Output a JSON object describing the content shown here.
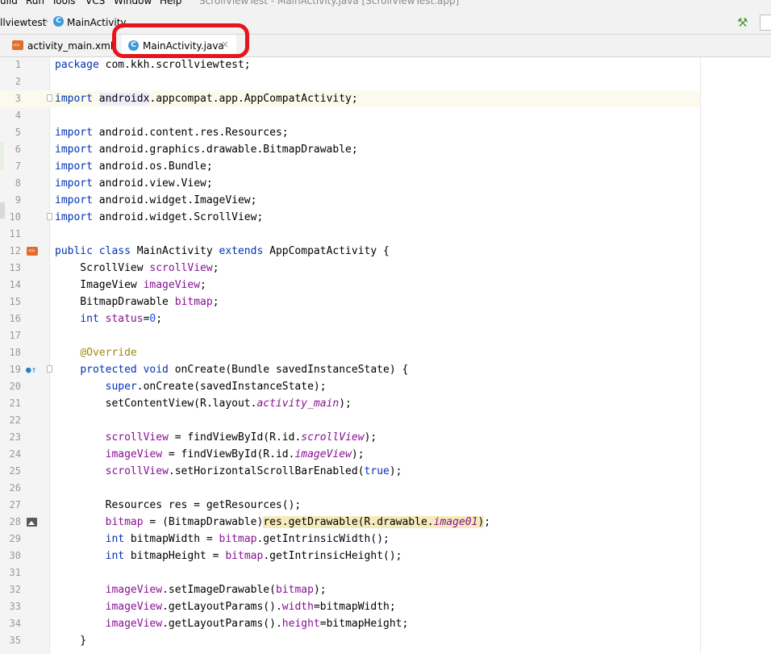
{
  "menubar": {
    "items": [
      "uild",
      "Run",
      "Tools",
      "VCS",
      "Window",
      "Help"
    ],
    "title": "ScrollViewTest - MainActivity.java [ScrollViewTest.app]"
  },
  "breadcrumb": {
    "project": "llviewtest",
    "file": "MainActivity",
    "file_icon_letter": "C"
  },
  "tabs": [
    {
      "label": "activity_main.xml",
      "icon": "xml-layout-icon",
      "active": false
    },
    {
      "label": "MainActivity.java",
      "icon": "java-class-icon",
      "icon_letter": "C",
      "active": true,
      "close": "×"
    }
  ],
  "colors": {
    "keyword": "#0033b3",
    "field": "#871094",
    "annotation": "#9e880d",
    "number": "#1750eb",
    "annotation_box": "#e8131c",
    "active_tab_underline": "#4083c9"
  },
  "editor": {
    "current_line": 3,
    "lines": [
      {
        "n": "1",
        "segs": [
          [
            "k",
            "package"
          ],
          [
            "t",
            " com.kkh.scrollviewtest;"
          ]
        ]
      },
      {
        "n": "2",
        "segs": []
      },
      {
        "n": "3",
        "segs": [
          [
            "k",
            "import"
          ],
          [
            "t",
            " "
          ],
          [
            "hl2",
            "androidx"
          ],
          [
            "t",
            ".appcompat.app.AppCompatActivity;"
          ]
        ],
        "fold": true
      },
      {
        "n": "4",
        "segs": []
      },
      {
        "n": "5",
        "segs": [
          [
            "k",
            "import"
          ],
          [
            "t",
            " android.content.res.Resources;"
          ]
        ]
      },
      {
        "n": "6",
        "segs": [
          [
            "k",
            "import"
          ],
          [
            "t",
            " android.graphics.drawable.BitmapDrawable;"
          ]
        ]
      },
      {
        "n": "7",
        "segs": [
          [
            "k",
            "import"
          ],
          [
            "t",
            " android.os.Bundle;"
          ]
        ]
      },
      {
        "n": "8",
        "segs": [
          [
            "k",
            "import"
          ],
          [
            "t",
            " android.view.View;"
          ]
        ]
      },
      {
        "n": "9",
        "segs": [
          [
            "k",
            "import"
          ],
          [
            "t",
            " android.widget.ImageView;"
          ]
        ]
      },
      {
        "n": "10",
        "segs": [
          [
            "k",
            "import"
          ],
          [
            "t",
            " android.widget.ScrollView;"
          ]
        ],
        "fold": true
      },
      {
        "n": "11",
        "segs": []
      },
      {
        "n": "12",
        "segs": [
          [
            "k",
            "public class"
          ],
          [
            "t",
            " MainActivity "
          ],
          [
            "k",
            "extends"
          ],
          [
            "t",
            " AppCompatActivity {"
          ]
        ],
        "gicon": "class-layout-icon"
      },
      {
        "n": "13",
        "segs": [
          [
            "t",
            "    ScrollView "
          ],
          [
            "f",
            "scrollView"
          ],
          [
            "t",
            ";"
          ]
        ]
      },
      {
        "n": "14",
        "segs": [
          [
            "t",
            "    ImageView "
          ],
          [
            "f",
            "imageView"
          ],
          [
            "t",
            ";"
          ]
        ]
      },
      {
        "n": "15",
        "segs": [
          [
            "t",
            "    BitmapDrawable "
          ],
          [
            "f",
            "bitmap"
          ],
          [
            "t",
            ";"
          ]
        ]
      },
      {
        "n": "16",
        "segs": [
          [
            "t",
            "    "
          ],
          [
            "k",
            "int"
          ],
          [
            "t",
            " "
          ],
          [
            "f",
            "status"
          ],
          [
            "t",
            "="
          ],
          [
            "n",
            "0"
          ],
          [
            "t",
            ";"
          ]
        ]
      },
      {
        "n": "17",
        "segs": []
      },
      {
        "n": "18",
        "segs": [
          [
            "t",
            "    "
          ],
          [
            "a",
            "@Override"
          ]
        ]
      },
      {
        "n": "19",
        "segs": [
          [
            "t",
            "    "
          ],
          [
            "k",
            "protected void"
          ],
          [
            "t",
            " "
          ],
          [
            "m",
            "onCreate"
          ],
          [
            "t",
            "(Bundle savedInstanceState) {"
          ]
        ],
        "gicon": "override-icon",
        "fold": true
      },
      {
        "n": "20",
        "segs": [
          [
            "t",
            "        "
          ],
          [
            "k",
            "super"
          ],
          [
            "t",
            ".onCreate(savedInstanceState);"
          ]
        ]
      },
      {
        "n": "21",
        "segs": [
          [
            "t",
            "        setContentView(R.layout."
          ],
          [
            "s",
            "activity_main"
          ],
          [
            "t",
            ");"
          ]
        ]
      },
      {
        "n": "22",
        "segs": []
      },
      {
        "n": "23",
        "segs": [
          [
            "t",
            "        "
          ],
          [
            "f",
            "scrollView"
          ],
          [
            "t",
            " = findViewById(R.id."
          ],
          [
            "s",
            "scrollView"
          ],
          [
            "t",
            ");"
          ]
        ]
      },
      {
        "n": "24",
        "segs": [
          [
            "t",
            "        "
          ],
          [
            "f",
            "imageView"
          ],
          [
            "t",
            " = findViewById(R.id."
          ],
          [
            "s",
            "imageView"
          ],
          [
            "t",
            ");"
          ]
        ]
      },
      {
        "n": "25",
        "segs": [
          [
            "t",
            "        "
          ],
          [
            "f",
            "scrollView"
          ],
          [
            "t",
            ".setHorizontalScrollBarEnabled("
          ],
          [
            "k",
            "true"
          ],
          [
            "t",
            ");"
          ]
        ]
      },
      {
        "n": "26",
        "segs": []
      },
      {
        "n": "27",
        "segs": [
          [
            "t",
            "        Resources res = getResources();"
          ]
        ]
      },
      {
        "n": "28",
        "segs": [
          [
            "t",
            "        "
          ],
          [
            "f",
            "bitmap"
          ],
          [
            "t",
            " = (BitmapDrawable)"
          ],
          [
            "hl",
            "res.getDrawable(R.drawable."
          ],
          [
            "hls",
            "image01"
          ],
          [
            "hl",
            ")"
          ],
          [
            "t",
            ";"
          ]
        ],
        "gicon": "image-icon"
      },
      {
        "n": "29",
        "segs": [
          [
            "t",
            "        "
          ],
          [
            "k",
            "int"
          ],
          [
            "t",
            " bitmapWidth = "
          ],
          [
            "f",
            "bitmap"
          ],
          [
            "t",
            ".getIntrinsicWidth();"
          ]
        ]
      },
      {
        "n": "30",
        "segs": [
          [
            "t",
            "        "
          ],
          [
            "k",
            "int"
          ],
          [
            "t",
            " bitmapHeight = "
          ],
          [
            "f",
            "bitmap"
          ],
          [
            "t",
            ".getIntrinsicHeight();"
          ]
        ]
      },
      {
        "n": "31",
        "segs": []
      },
      {
        "n": "32",
        "segs": [
          [
            "t",
            "        "
          ],
          [
            "f",
            "imageView"
          ],
          [
            "t",
            ".setImageDrawable("
          ],
          [
            "f",
            "bitmap"
          ],
          [
            "t",
            ");"
          ]
        ]
      },
      {
        "n": "33",
        "segs": [
          [
            "t",
            "        "
          ],
          [
            "f",
            "imageView"
          ],
          [
            "t",
            ".getLayoutParams()."
          ],
          [
            "f",
            "width"
          ],
          [
            "t",
            "=bitmapWidth;"
          ]
        ]
      },
      {
        "n": "34",
        "segs": [
          [
            "t",
            "        "
          ],
          [
            "f",
            "imageView"
          ],
          [
            "t",
            ".getLayoutParams()."
          ],
          [
            "f",
            "height"
          ],
          [
            "t",
            "=bitmapHeight;"
          ]
        ]
      },
      {
        "n": "35",
        "segs": [
          [
            "t",
            "    }"
          ]
        ]
      }
    ]
  }
}
